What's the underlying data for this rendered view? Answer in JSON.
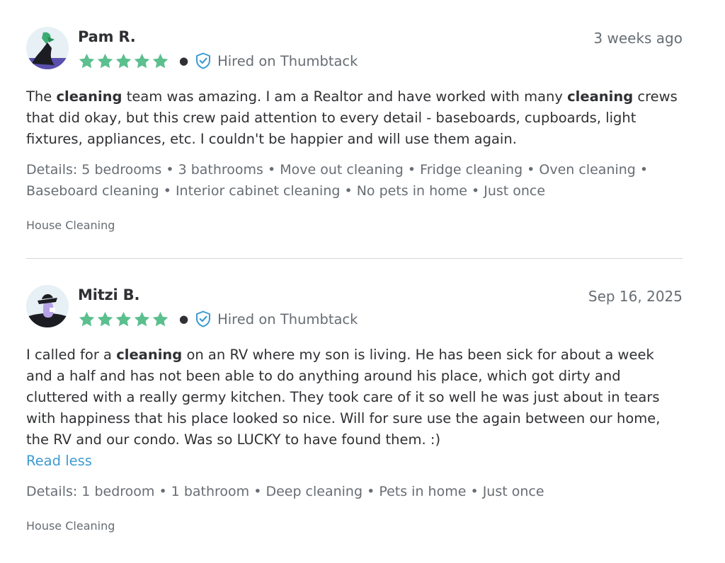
{
  "reviews": [
    {
      "reviewer": "Pam R.",
      "date": "3 weeks ago",
      "rating": 5,
      "hired_label": "Hired on Thumbtack",
      "body": {
        "t1": "The ",
        "k1": "cleaning",
        "t2": " team was amazing. I am a Realtor and have worked with many ",
        "k2": "cleaning",
        "t3": " crews that did okay, but this crew paid attention to every detail - baseboards, cupboards, light fixtures, appliances, etc. I couldn't be happier and will use them again."
      },
      "details": "Details: 5 bedrooms • 3 bathrooms • Move out cleaning • Fridge cleaning • Oven cleaning • Baseboard cleaning • Interior cabinet cleaning • No pets in home • Just once",
      "category": "House Cleaning"
    },
    {
      "reviewer": "Mitzi B.",
      "date": "Sep 16, 2025",
      "rating": 5,
      "hired_label": "Hired on Thumbtack",
      "body": {
        "t1": "I called for a ",
        "k1": "cleaning",
        "t2": " on an RV where my son is living. He has been sick for about a week and a half and has not been able to do anything around his place, which got dirty and cluttered with a really germy kitchen. They took care of it so well he was just about in tears with happiness that his place looked so nice. Will for sure use the again between our home, the RV and our condo. Was so LUCKY to have found them. :)"
      },
      "read_less": "Read less",
      "details": "Details: 1 bedroom • 1 bathroom • Deep cleaning • Pets in home • Just once",
      "category": "House Cleaning"
    }
  ],
  "colors": {
    "star": "#5bbf8e",
    "link": "#3d9bd1",
    "shield": "#3d9bd1"
  },
  "icons": {
    "avatar": "avatar-illustration",
    "star": "star-icon",
    "verified": "shield-check-icon"
  }
}
